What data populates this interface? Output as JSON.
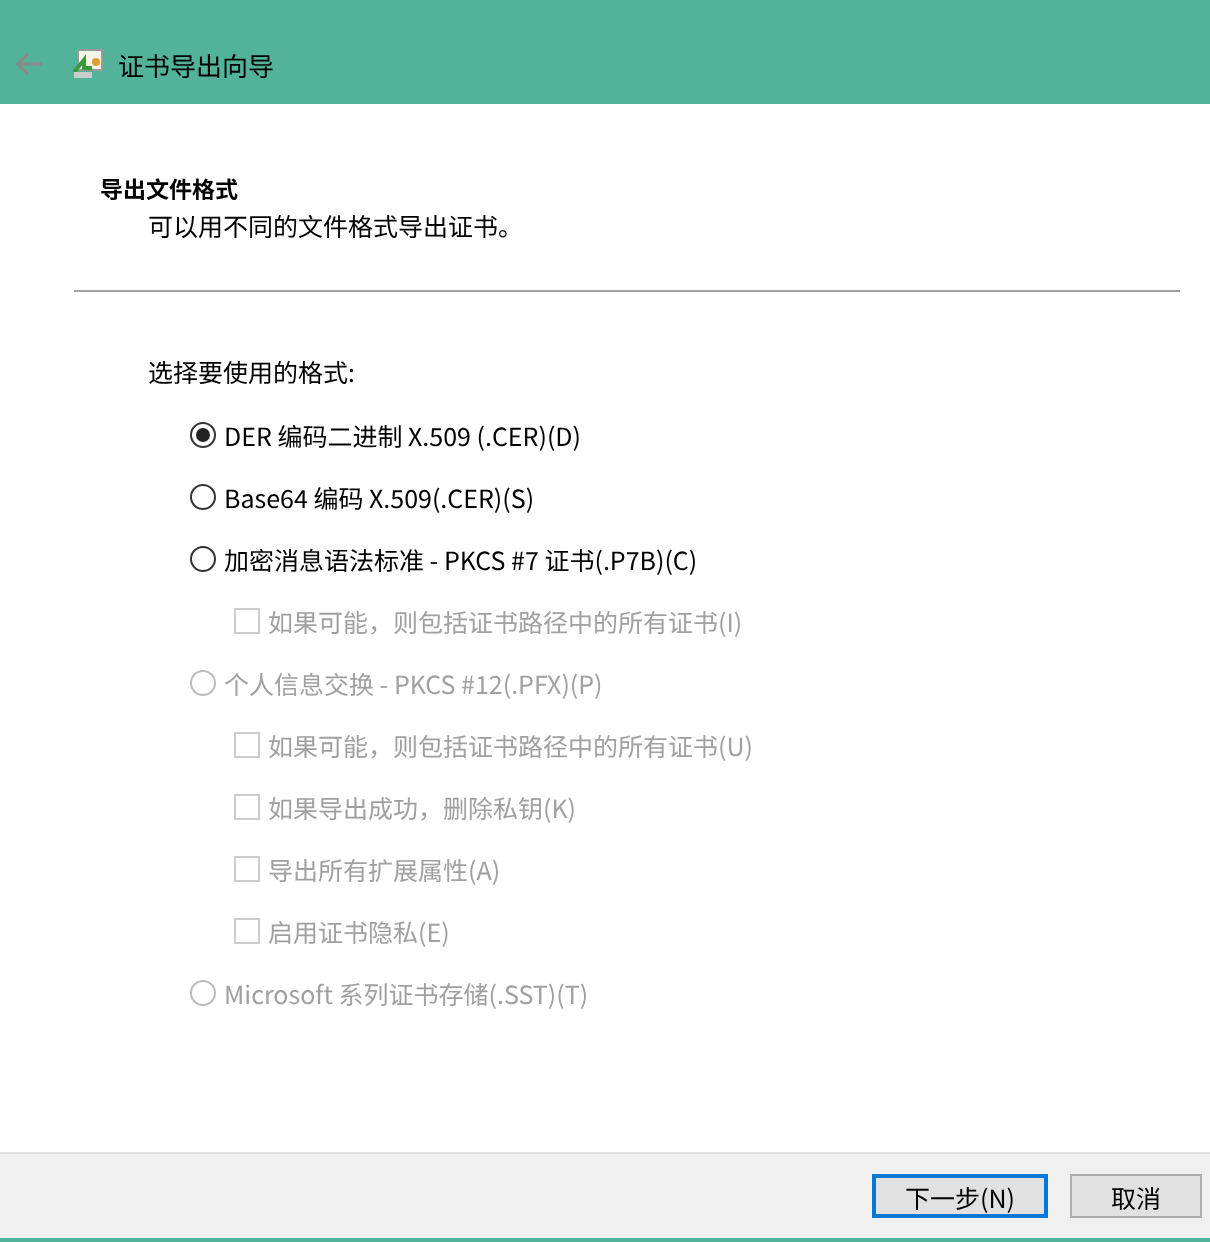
{
  "window": {
    "title": "证书导出向导"
  },
  "page": {
    "heading": "导出文件格式",
    "description": "可以用不同的文件格式导出证书。"
  },
  "prompt": "选择要使用的格式:",
  "formats": [
    {
      "label": "DER 编码二进制 X.509 (.CER)(D)",
      "selected": true,
      "disabled": false
    },
    {
      "label": "Base64 编码 X.509(.CER)(S)",
      "selected": false,
      "disabled": false
    },
    {
      "label": "加密消息语法标准 - PKCS #7 证书(.P7B)(C)",
      "selected": false,
      "disabled": false,
      "children": [
        {
          "label": "如果可能，则包括证书路径中的所有证书(I)",
          "checked": false,
          "disabled": true
        }
      ]
    },
    {
      "label": "个人信息交换 - PKCS #12(.PFX)(P)",
      "selected": false,
      "disabled": true,
      "children": [
        {
          "label": "如果可能，则包括证书路径中的所有证书(U)",
          "checked": false,
          "disabled": true
        },
        {
          "label": "如果导出成功，删除私钥(K)",
          "checked": false,
          "disabled": true
        },
        {
          "label": "导出所有扩展属性(A)",
          "checked": false,
          "disabled": true
        },
        {
          "label": "启用证书隐私(E)",
          "checked": false,
          "disabled": true
        }
      ]
    },
    {
      "label": "Microsoft 系列证书存储(.SST)(T)",
      "selected": false,
      "disabled": true
    }
  ],
  "buttons": [
    {
      "label": "下一步(N)",
      "kind": "default"
    },
    {
      "label": "取消",
      "kind": "normal"
    }
  ]
}
